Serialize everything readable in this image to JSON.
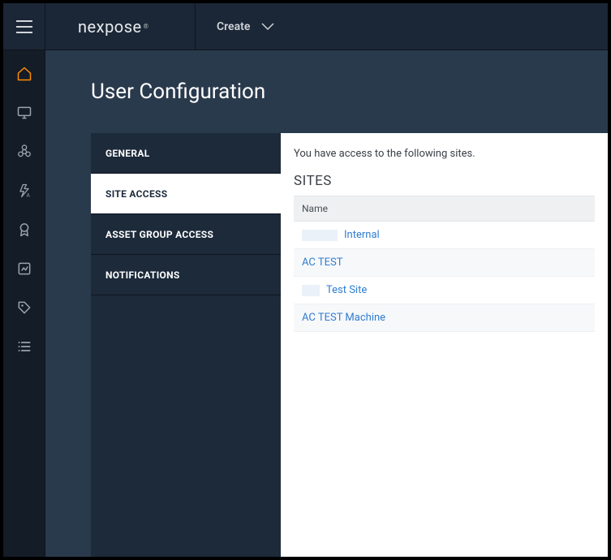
{
  "header": {
    "brand": "nexpose",
    "create_label": "Create"
  },
  "rail": {
    "items": [
      {
        "name": "home-icon",
        "active": true
      },
      {
        "name": "monitor-icon",
        "active": false
      },
      {
        "name": "biohazard-icon",
        "active": false
      },
      {
        "name": "automation-icon",
        "active": false
      },
      {
        "name": "badge-icon",
        "active": false
      },
      {
        "name": "report-icon",
        "active": false
      },
      {
        "name": "tag-icon",
        "active": false
      },
      {
        "name": "list-icon",
        "active": false
      }
    ]
  },
  "page": {
    "title": "User Configuration"
  },
  "config_tabs": [
    {
      "label": "GENERAL",
      "active": false
    },
    {
      "label": "SITE ACCESS",
      "active": true
    },
    {
      "label": "ASSET GROUP ACCESS",
      "active": false
    },
    {
      "label": "NOTIFICATIONS",
      "active": false
    }
  ],
  "site_access": {
    "intro": "You have access to the following sites.",
    "heading": "SITES",
    "column": "Name",
    "rows": [
      {
        "label": "Internal",
        "masked": true,
        "mask_size": "large"
      },
      {
        "label": "AC TEST",
        "masked": false
      },
      {
        "label": "Test Site",
        "masked": true,
        "mask_size": "small"
      },
      {
        "label": "AC TEST Machine",
        "masked": false
      }
    ]
  }
}
